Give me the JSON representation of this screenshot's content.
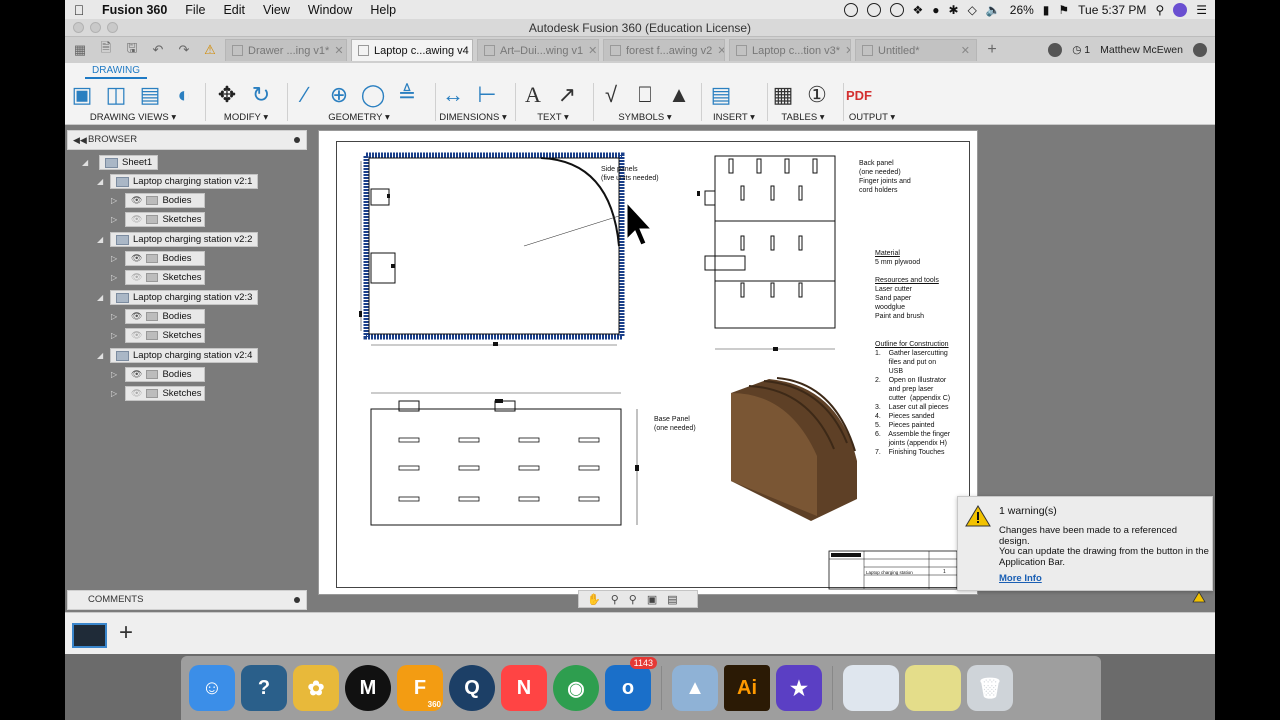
{
  "menubar": {
    "app_name": "Fusion 360",
    "items": [
      "File",
      "Edit",
      "View",
      "Window",
      "Help"
    ],
    "battery": "26%",
    "clock": "Tue 5:37 PM"
  },
  "window": {
    "title": "Autodesk Fusion 360 (Education License)"
  },
  "tabs": [
    {
      "label": "Drawer ...ing v1*",
      "active": false
    },
    {
      "label": "Laptop c...awing v4",
      "active": true
    },
    {
      "label": "Art–Dui...wing v1",
      "active": false
    },
    {
      "label": "forest f...awing v2",
      "active": false
    },
    {
      "label": "Laptop c...tion v3*",
      "active": false
    },
    {
      "label": "Untitled*",
      "active": false
    }
  ],
  "tabbar": {
    "job_count": "1",
    "user_name": "Matthew McEwen"
  },
  "ribbon": {
    "workspace": "DRAWING",
    "groups": [
      {
        "label": "DRAWING VIEWS ▾"
      },
      {
        "label": "MODIFY ▾"
      },
      {
        "label": "GEOMETRY ▾"
      },
      {
        "label": "DIMENSIONS ▾"
      },
      {
        "label": "TEXT ▾"
      },
      {
        "label": "SYMBOLS ▾"
      },
      {
        "label": "INSERT ▾"
      },
      {
        "label": "TABLES ▾"
      },
      {
        "label": "OUTPUT ▾"
      }
    ]
  },
  "browser": {
    "title": "BROWSER",
    "sheet": "Sheet1",
    "components": [
      {
        "name": "Laptop charging station v2:1",
        "children": [
          "Bodies",
          "Sketches"
        ]
      },
      {
        "name": "Laptop charging station v2:2",
        "children": [
          "Bodies",
          "Sketches"
        ]
      },
      {
        "name": "Laptop charging station v2:3",
        "children": [
          "Bodies",
          "Sketches"
        ]
      },
      {
        "name": "Laptop charging station v2:4",
        "children": [
          "Bodies",
          "Sketches"
        ]
      }
    ],
    "comments_title": "COMMENTS"
  },
  "drawing": {
    "side_note": "Side panels\n(five units needed)",
    "back_note": "Back panel\n(one needed)\nFinger joints and\ncord holders",
    "base_note": "Base Panel\n(one needed)",
    "material_title": "Material",
    "material": "5 mm plywood",
    "resources_title": "Resources and tools",
    "resources": "Laser cutter\nSand paper\nwoodglue\nPaint and brush",
    "outline_title": "Outline for Construction",
    "outline": "1.    Gather lasercutting\n       files and put on\n       USB\n2.    Open on Illustrator\n       and prep laser\n       cutter  (appendix C)\n3.    Laser cut all pieces\n4.    Pieces sanded\n5.    Pieces painted\n6.    Assemble the finger\n       joints (appendix H)\n7.    Finishing Touches",
    "title_block_name": "Laptop charging station",
    "title_block_sheet": "1"
  },
  "warning": {
    "title": "1 warning(s)",
    "body": "Changes have been made to a referenced design.\nYou can update the drawing from the button in the Application Bar.",
    "link": "More Info"
  },
  "dock": {
    "apps": [
      "Finder",
      "Help Viewer",
      "Tentacle",
      "Mendeley",
      "Fusion 360",
      "QuickTime Player",
      "News",
      "Google Chrome",
      "Outlook",
      "Preview",
      "Adobe Illustrator",
      "iMovie"
    ],
    "outlook_badge": "1143",
    "fusion_label": "360",
    "illustrator_label": "Ai"
  },
  "colors": {
    "accent": "#1f7ac4",
    "selection": "#1a3f8a",
    "warning": "#f2c200",
    "wood": "#6b4a2a"
  }
}
